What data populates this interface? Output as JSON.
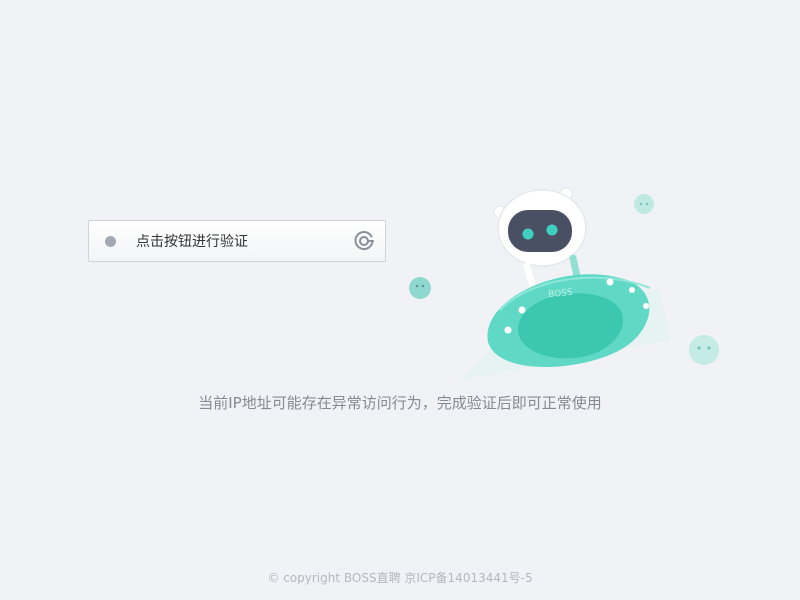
{
  "verify": {
    "label": "点击按钮进行验证"
  },
  "notice": {
    "text": "当前IP地址可能存在异常访问行为，完成验证后即可正常使用"
  },
  "illustration": {
    "ufo_text": "BOSS"
  },
  "footer": {
    "text": "© copyright BOSS直聘 京ICP备14013441号-5"
  },
  "colors": {
    "background": "#f1f2f6",
    "accent_teal": "#4fd6c0",
    "dot_gray": "#a3a9b3"
  }
}
